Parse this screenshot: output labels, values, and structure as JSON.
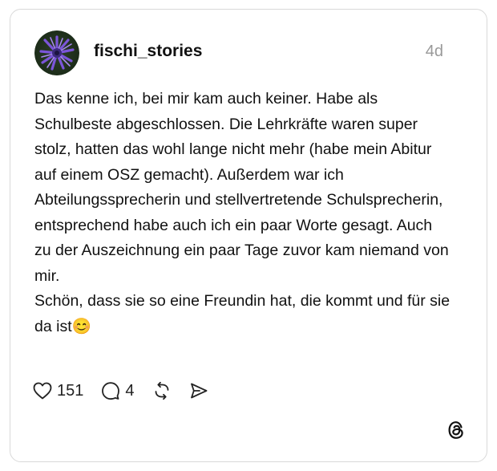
{
  "post": {
    "username": "fischi_stories",
    "time": "4d",
    "text": "Das kenne ich, bei mir kam auch keiner. Habe als Schulbeste abgeschlossen. Die Lehrkräfte waren super stolz, hatten das wohl lange nicht mehr (habe mein Abitur auf einem OSZ gemacht). Außerdem war ich Abteilungssprecherin und stellvertretende Schulsprecherin, entsprechend habe auch ich ein paar Worte gesagt. Auch zu der Auszeichnung ein paar Tage zuvor kam niemand von mir.\nSchön, dass sie so eine Freundin hat, die kommt und für sie da ist😊"
  },
  "actions": {
    "likes": "151",
    "replies": "4"
  },
  "icons": {
    "like": "heart-icon",
    "reply": "comment-icon",
    "repost": "repost-icon",
    "share": "share-icon",
    "brand": "threads-logo-icon"
  },
  "colors": {
    "text": "#111111",
    "muted": "#999999",
    "border": "#d9d9d9"
  }
}
